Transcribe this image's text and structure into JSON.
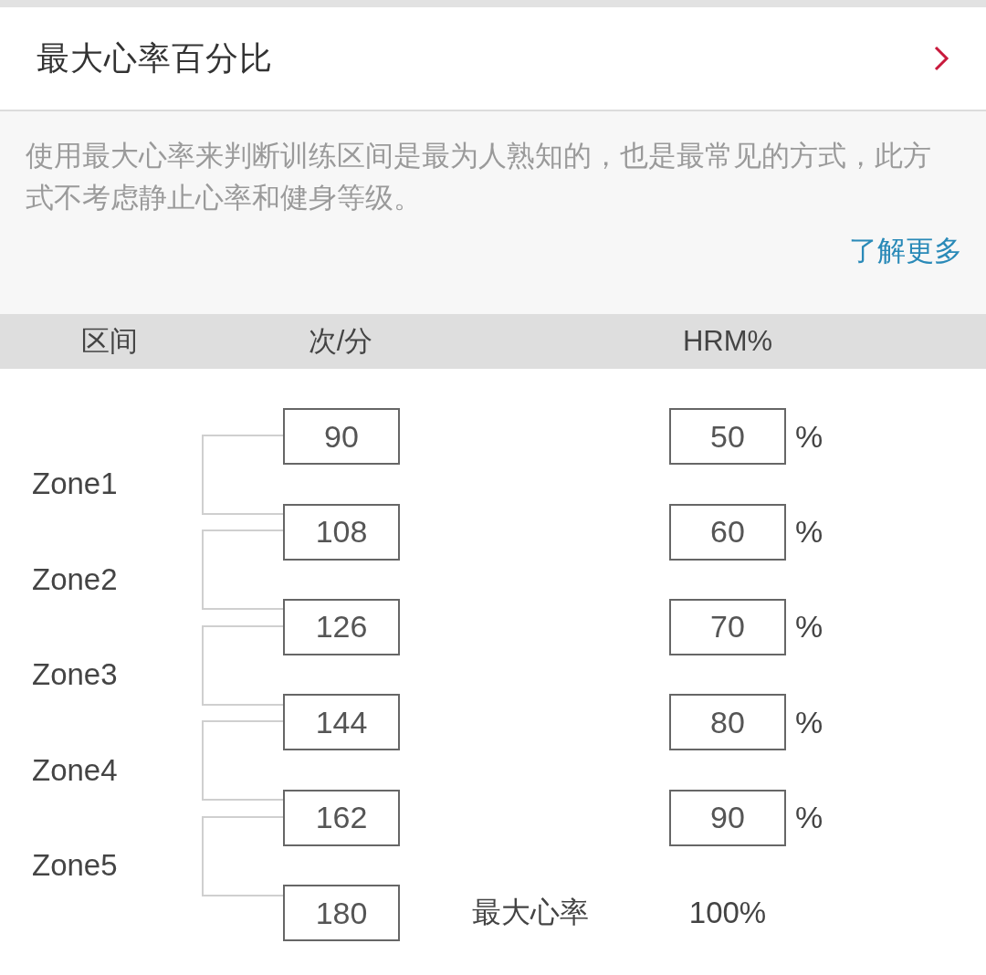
{
  "header": {
    "title": "最大心率百分比"
  },
  "description": {
    "text": "使用最大心率来判断训练区间是最为人熟知的，也是最常见的方式，此方式不考虑静止心率和健身等级。",
    "link": "了解更多"
  },
  "table": {
    "columns": [
      "区间",
      "次/分",
      "HRM%"
    ],
    "zones": [
      "Zone1",
      "Zone2",
      "Zone3",
      "Zone4",
      "Zone5"
    ],
    "rows": [
      {
        "kind": "field",
        "bpm": "90",
        "hrm": "50",
        "unit": "%"
      },
      {
        "kind": "field",
        "bpm": "108",
        "hrm": "60",
        "unit": "%"
      },
      {
        "kind": "field",
        "bpm": "126",
        "hrm": "70",
        "unit": "%"
      },
      {
        "kind": "field",
        "bpm": "144",
        "hrm": "80",
        "unit": "%"
      },
      {
        "kind": "field",
        "bpm": "162",
        "hrm": "90",
        "unit": "%"
      },
      {
        "kind": "max",
        "bpm": "180",
        "label": "最大心率",
        "hrm": "100%"
      }
    ]
  }
}
